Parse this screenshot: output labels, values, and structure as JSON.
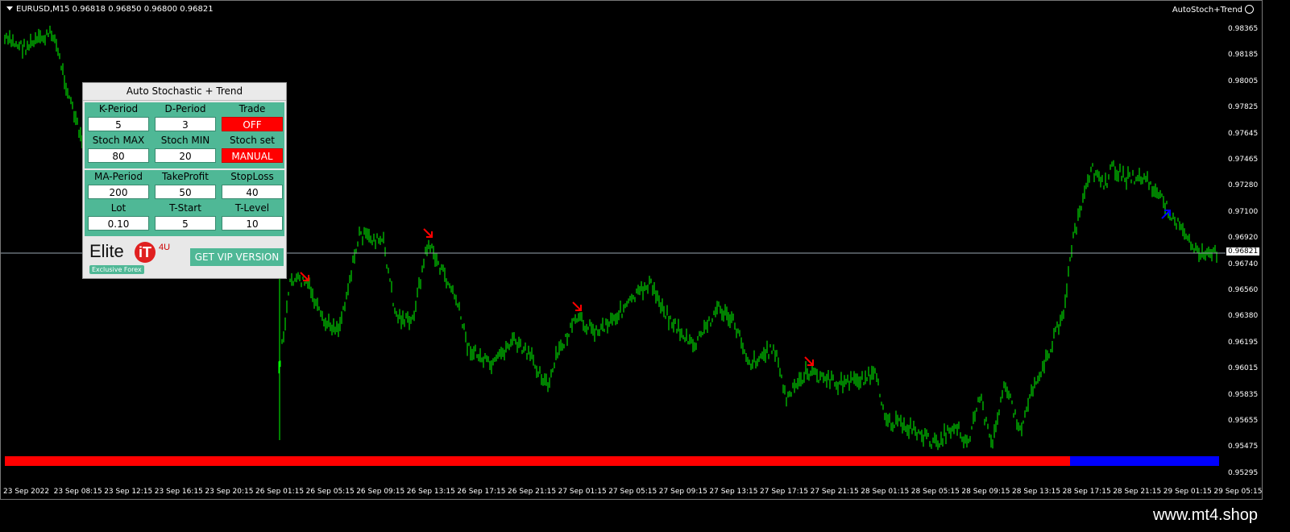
{
  "header": {
    "symbol_info": "EURUSD,M15  0.96818 0.96850 0.96800 0.96821",
    "indicator_label": "AutoStoch+Trend"
  },
  "y_axis": {
    "labels": [
      "0.98365",
      "0.98185",
      "0.98005",
      "0.97825",
      "0.97645",
      "0.97465",
      "0.97280",
      "0.97100",
      "0.96920",
      "0.96740",
      "0.96560",
      "0.96380",
      "0.96195",
      "0.96015",
      "0.95835",
      "0.95655",
      "0.95475",
      "0.95295"
    ],
    "current_price": "0.96821"
  },
  "x_axis": {
    "labels": [
      "23 Sep 2022",
      "23 Sep 08:15",
      "23 Sep 12:15",
      "23 Sep 16:15",
      "23 Sep 20:15",
      "26 Sep 01:15",
      "26 Sep 05:15",
      "26 Sep 09:15",
      "26 Sep 13:15",
      "26 Sep 17:15",
      "26 Sep 21:15",
      "27 Sep 01:15",
      "27 Sep 05:15",
      "27 Sep 09:15",
      "27 Sep 13:15",
      "27 Sep 17:15",
      "27 Sep 21:15",
      "28 Sep 01:15",
      "28 Sep 05:15",
      "28 Sep 09:15",
      "28 Sep 13:15",
      "28 Sep 17:15",
      "28 Sep 21:15",
      "29 Sep 01:15",
      "29 Sep 05:15"
    ]
  },
  "colors": {
    "candles": "#00ff00",
    "signal_arrow": "#ff0000",
    "trend_down": "#ff0000",
    "trend_up": "#0000ff",
    "panel_accent": "#4fb896"
  },
  "panel": {
    "title": "Auto Stochastic + Trend",
    "row1": {
      "k_label": "K-Period",
      "d_label": "D-Period",
      "trade_label": "Trade",
      "k_value": "5",
      "d_value": "3",
      "trade_value": "OFF"
    },
    "row2": {
      "max_label": "Stoch MAX",
      "min_label": "Stoch MIN",
      "set_label": "Stoch set",
      "max_value": "80",
      "min_value": "20",
      "set_value": "MANUAL"
    },
    "row3": {
      "ma_label": "MA-Period",
      "tp_label": "TakeProfit",
      "sl_label": "StopLoss",
      "ma_value": "200",
      "tp_value": "50",
      "sl_value": "40"
    },
    "row4": {
      "lot_label": "Lot",
      "tstart_label": "T-Start",
      "tlevel_label": "T-Level",
      "lot_value": "0.10",
      "tstart_value": "5",
      "tlevel_value": "10"
    },
    "logo_text": "Elite",
    "logo_sub": "Exclusive Forex",
    "logo_badge": "4U",
    "vip_button": "GET VIP VERSION"
  },
  "footer": {
    "text": "www.mt4.shop"
  }
}
